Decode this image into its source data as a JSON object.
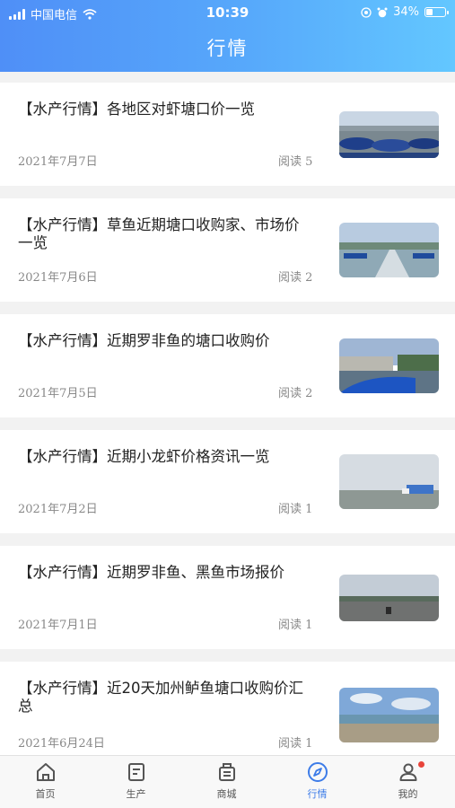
{
  "status_bar": {
    "carrier": "中国电信",
    "time": "10:39",
    "battery": "34%",
    "battery_level": 0.34
  },
  "header": {
    "title": "行情"
  },
  "articles": [
    {
      "title": "【水产行情】各地区对虾塘口价一览",
      "date": "2021年7月7日",
      "reads": "阅读 5"
    },
    {
      "title": "【水产行情】草鱼近期塘口收购家、市场价一览",
      "date": "2021年7月6日",
      "reads": "阅读 2"
    },
    {
      "title": "【水产行情】近期罗非鱼的塘口收购价",
      "date": "2021年7月5日",
      "reads": "阅读 2"
    },
    {
      "title": "【水产行情】近期小龙虾价格资讯一览",
      "date": "2021年7月2日",
      "reads": "阅读 1"
    },
    {
      "title": "【水产行情】近期罗非鱼、黑鱼市场报价",
      "date": "2021年7月1日",
      "reads": "阅读 1"
    },
    {
      "title": "【水产行情】近20天加州鲈鱼塘口收购价汇总",
      "date": "2021年6月24日",
      "reads": "阅读 1"
    }
  ],
  "tabbar": {
    "tabs": [
      {
        "label": "首页",
        "icon": "home-icon"
      },
      {
        "label": "生产",
        "icon": "document-icon"
      },
      {
        "label": "商城",
        "icon": "shop-icon"
      },
      {
        "label": "行情",
        "icon": "compass-icon",
        "active": true
      },
      {
        "label": "我的",
        "icon": "user-icon",
        "badge": true
      }
    ]
  },
  "colors": {
    "accent": "#3d7ce8",
    "header_start": "#4f8ff7",
    "header_end": "#63c7ff",
    "badge": "#e8443a"
  }
}
